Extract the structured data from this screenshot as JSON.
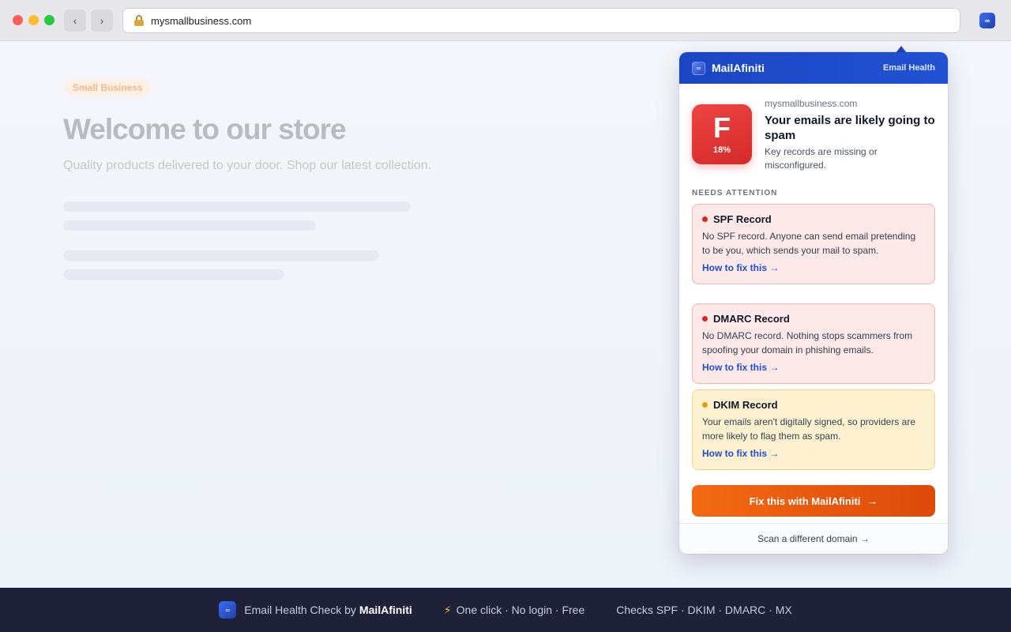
{
  "browser": {
    "url": "mysmallbusiness.com",
    "back_label": "‹",
    "forward_label": "›",
    "extension_icon": "∞"
  },
  "page": {
    "badge": "Small Business",
    "title": "Welcome to our store",
    "subtitle": "Quality products delivered to your door. Shop our latest collection."
  },
  "popup": {
    "logo": "∞",
    "brand": "MailAfiniti",
    "tag": "Email Health",
    "grade": {
      "letter": "F",
      "percent": "18%"
    },
    "domain": "mysmallbusiness.com",
    "headline": "Your emails are likely going to spam",
    "description": "Key records are missing or misconfigured.",
    "section_label": "NEEDS ATTENTION",
    "issues": [
      {
        "title": "SPF Record",
        "severity": "critical",
        "dot_color": "#dc2626",
        "description": "No SPF record. Anyone can send email pretending to be you, which sends your mail to spam.",
        "link": "How to fix this →"
      },
      {
        "title": "DMARC Record",
        "severity": "critical",
        "dot_color": "#dc2626",
        "description": "No DMARC record. Nothing stops scammers from spoofing your domain in phishing emails.",
        "link": "How to fix this →"
      },
      {
        "title": "DKIM Record",
        "severity": "warning",
        "dot_color": "#e2a008",
        "description": "Your emails aren't digitally signed, so providers are more likely to flag them as spam.",
        "link": "How to fix this →"
      }
    ],
    "cta_label": "Fix this with MailAfiniti",
    "cta_arrow": "→",
    "footer_link": "Scan a different domain →"
  },
  "banner": {
    "logo": "∞",
    "prefix": "Email Health Check by",
    "brand": "MailAfiniti",
    "bolt": "⚡",
    "features": "One click · No login · Free",
    "checks": "Checks SPF · DKIM · DMARC · MX"
  },
  "colors": {
    "accent": "#1d4ed8",
    "header": "#1c45c2",
    "cta": "#ea580c",
    "critical": "#dc2626",
    "warning": "#e2a008",
    "banner_bg": "#1e2137"
  }
}
